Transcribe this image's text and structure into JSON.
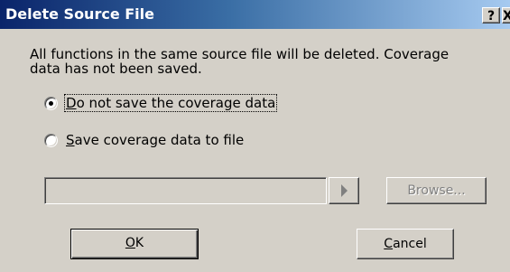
{
  "window": {
    "title": "Delete Source File",
    "help_label": "?",
    "close_label": "X"
  },
  "message": {
    "line1": "All functions in the same source file will be deleted. Coverage",
    "line2": "data has not been saved."
  },
  "options": [
    {
      "mnemonic": "D",
      "rest": "o not save the coverage data",
      "selected": true
    },
    {
      "mnemonic": "S",
      "rest": "ave coverage data to file",
      "selected": false
    }
  ],
  "file_path": {
    "value": ""
  },
  "buttons": {
    "browse_label": "Browse...",
    "ok_mnemonic": "O",
    "ok_rest": "K",
    "cancel_mnemonic": "C",
    "cancel_rest": "ancel"
  },
  "colors": {
    "titlebar_start": "#0a246a",
    "titlebar_end": "#a6caf0",
    "face": "#d4d0c8"
  }
}
